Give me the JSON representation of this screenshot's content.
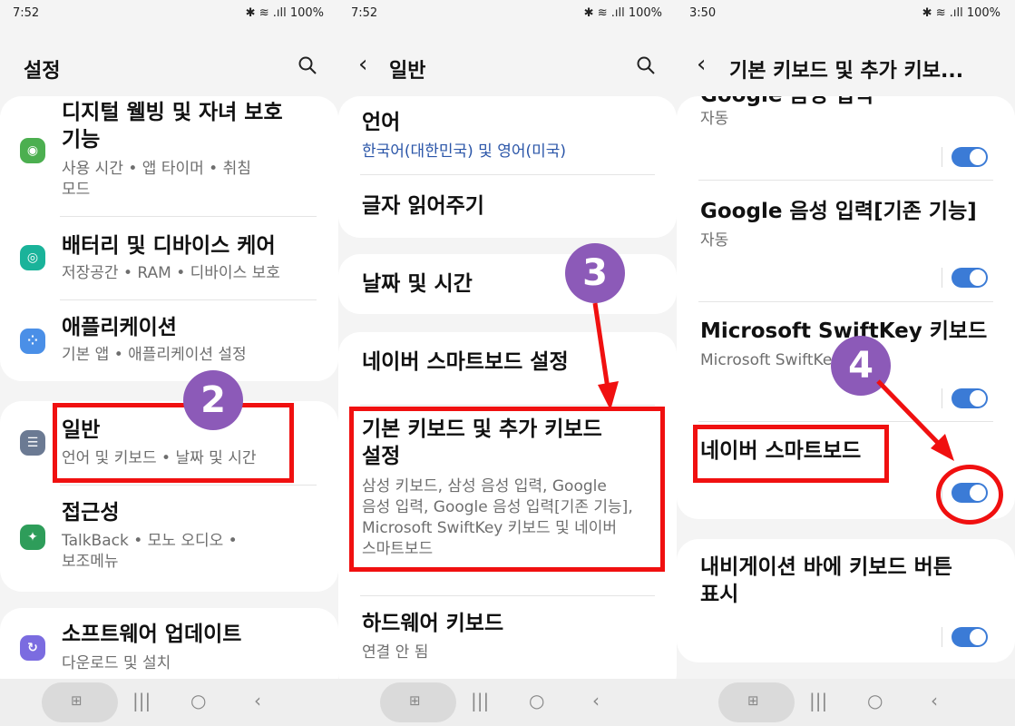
{
  "colors": {
    "accent": "#3b7bd6",
    "annotation_red": "#f01010",
    "badge_purple": "#8c5ab8",
    "link_blue": "#2a55a8"
  },
  "panels": [
    {
      "status": {
        "time": "7:52",
        "battery": "100%"
      },
      "title": "설정",
      "items": [
        {
          "title_1": "디지털 웰빙 및 자녀 보호",
          "title_2": "기능",
          "sub_1": "사용 시간 • 앱 타이머 • 취침",
          "sub_2": "모드",
          "icon": "digital-wellbeing-icon"
        },
        {
          "title": "배터리 및 디바이스 케어",
          "sub": "저장공간 • RAM • 디바이스 보호",
          "icon": "device-care-icon"
        },
        {
          "title": "애플리케이션",
          "sub": "기본 앱 • 애플리케이션 설정",
          "icon": "apps-icon"
        },
        {
          "title": "일반",
          "sub": "언어 및 키보드 • 날짜 및 시간",
          "icon": "general-management-icon"
        },
        {
          "title": "접근성",
          "sub_1": "TalkBack • 모노 오디오 •",
          "sub_2": "보조메뉴",
          "icon": "accessibility-icon"
        },
        {
          "title": "소프트웨어 업데이트",
          "sub": "다운로드 및 설치",
          "icon": "software-update-icon"
        }
      ],
      "step_badge": "2"
    },
    {
      "status": {
        "time": "7:52",
        "battery": "100%"
      },
      "title": "일반",
      "items": [
        {
          "title": "언어",
          "sub": "한국어(대한민국) 및 영어(미국)"
        },
        {
          "title": "글자 읽어주기"
        },
        {
          "title": "날짜 및 시간"
        },
        {
          "title": "네이버 스마트보드 설정"
        },
        {
          "title_1": "기본 키보드 및 추가 키보드",
          "title_2": "설정",
          "sub_1": "삼성 키보드, 삼성 음성 입력, Google",
          "sub_2": "음성 입력, Google 음성 입력[기존 기능],",
          "sub_3": "Microsoft SwiftKey 키보드 및 네이버",
          "sub_4": "스마트보드"
        },
        {
          "title": "하드웨어 키보드",
          "sub": "연결 안 됨"
        }
      ],
      "step_badge": "3"
    },
    {
      "status": {
        "time": "3:50",
        "battery": "100%"
      },
      "title": "기본 키보드 및 추가 키보...",
      "items": [
        {
          "title": "Google 음성 입력",
          "sub": "자동",
          "toggle": true
        },
        {
          "title": "Google 음성 입력[기존 기능]",
          "sub": "자동",
          "toggle": true
        },
        {
          "title": "Microsoft SwiftKey 키보드",
          "sub": "Microsoft SwiftKey 키보드",
          "toggle": true
        },
        {
          "title": "네이버 스마트보드",
          "toggle": true
        },
        {
          "title_1": "내비게이션 바에 키보드 버튼",
          "title_2": "표시",
          "toggle": true
        }
      ],
      "step_badge": "4"
    }
  ]
}
